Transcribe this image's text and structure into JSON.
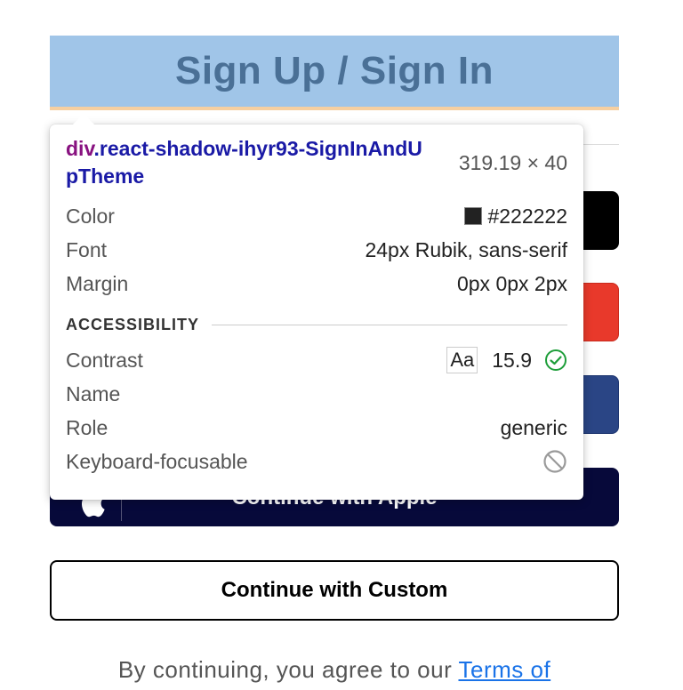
{
  "heading": {
    "title": "Sign Up / Sign In"
  },
  "tooltip": {
    "selector_tag": "div",
    "selector_class": ".react-shadow-ihyr93-SignInAndUpTheme",
    "size": "319.19 × 40",
    "rows": {
      "color_label": "Color",
      "color_value": "#222222",
      "font_label": "Font",
      "font_value": "24px Rubik, sans-serif",
      "margin_label": "Margin",
      "margin_value": "0px 0px 2px"
    },
    "accessibility": {
      "section_title": "ACCESSIBILITY",
      "contrast_label": "Contrast",
      "contrast_sample": "Aa",
      "contrast_value": "15.9",
      "name_label": "Name",
      "name_value": "",
      "role_label": "Role",
      "role_value": "generic",
      "keyboard_label": "Keyboard-focusable"
    },
    "colors": {
      "tag": "#881280",
      "selector": "#1a1aa6",
      "check": "#1e9e3a"
    }
  },
  "buttons": {
    "apple_label": "Continue with Apple",
    "custom_label": "Continue with Custom"
  },
  "footer": {
    "terms_prefix": "By continuing, you agree to our ",
    "terms_link": "Terms of"
  }
}
